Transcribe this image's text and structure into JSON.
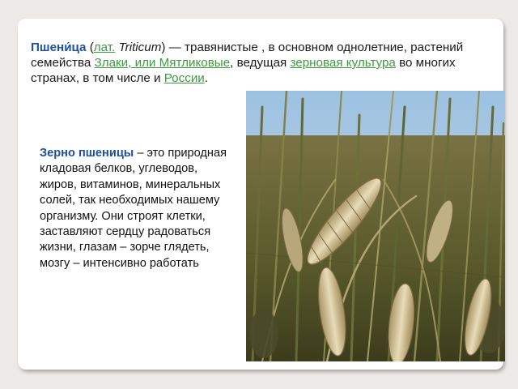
{
  "intro": {
    "term": "Пшени́ца",
    "open_paren": " (",
    "lat_link": "лат.",
    "space": " ",
    "latin_name": "Triticum",
    "after_latin": ") — травянистые , в основном однолетние, растений семейства ",
    "family_link": "Злаки, или Мятликовые",
    "middle": ", ведущая ",
    "crop_link": "зерновая культура",
    "before_russia": " во многих странах, в том числе и ",
    "russia_link": "России",
    "end": "."
  },
  "side": {
    "term": "Зерно пшеницы",
    "text": " – это природная кладовая белков, углеводов, жиров, витаминов, минеральных солей, так необходимых нашему организму. Они строят клетки, заставляют сердцу радоваться жизни, глазам – зорче глядеть, мозгу – интенсивно работать"
  },
  "colors": {
    "term": "#1f4fa0",
    "link": "#3f9a3f",
    "text": "#1a1a1a",
    "background": "#ece9e6"
  }
}
